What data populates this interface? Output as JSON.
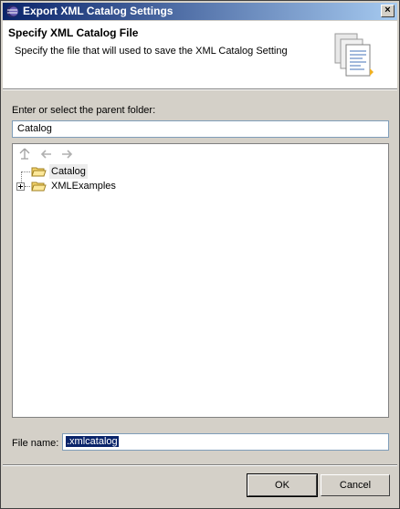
{
  "window": {
    "title": "Export XML Catalog Settings",
    "close_label": "×"
  },
  "header": {
    "title": "Specify XML Catalog File",
    "description": "Specify the file that will used to save the XML Catalog Setting"
  },
  "folder": {
    "label": "Enter or select the parent folder:",
    "value": "Catalog"
  },
  "tree": {
    "items": [
      {
        "label": "Catalog",
        "selected": true,
        "expandable": false
      },
      {
        "label": "XMLExamples",
        "selected": false,
        "expandable": true
      }
    ]
  },
  "file": {
    "label": "File name:",
    "value": ".xmlcatalog"
  },
  "buttons": {
    "ok": "OK",
    "cancel": "Cancel"
  },
  "colors": {
    "titlebar_start": "#0a246a",
    "titlebar_end": "#a6caf0",
    "dialog_bg": "#d4d0c8",
    "selection": "#0a246a"
  }
}
